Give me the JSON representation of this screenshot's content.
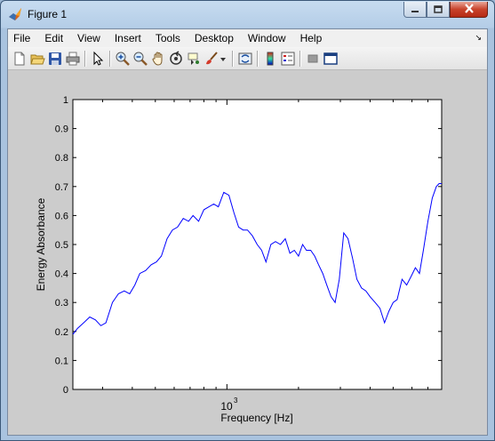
{
  "window": {
    "title": "Figure 1",
    "icon": "matlab-icon",
    "controls": [
      "minimize-icon",
      "maximize-icon",
      "close-icon"
    ]
  },
  "menubar": {
    "items": [
      "File",
      "Edit",
      "View",
      "Insert",
      "Tools",
      "Desktop",
      "Window",
      "Help"
    ],
    "overflow_icon": "chevron-icon"
  },
  "toolbar": {
    "icons": [
      "new-figure-icon",
      "open-file-icon",
      "save-icon",
      "print-icon",
      "edit-plot-icon",
      "zoom-in-icon",
      "zoom-out-icon",
      "pan-icon",
      "rotate-3d-icon",
      "data-cursor-icon",
      "brush-icon",
      "link-plot-icon",
      "colorbar-icon",
      "legend-icon",
      "hide-plot-tools-icon",
      "show-plot-tools-icon"
    ]
  },
  "chart_data": {
    "type": "line",
    "title": "",
    "xlabel": "Frequency [Hz]",
    "ylabel": "Energy Absorbance",
    "x_scale": "log",
    "xlim": [
      225,
      8000
    ],
    "ylim": [
      0,
      1
    ],
    "yticks": [
      0,
      0.1,
      0.2,
      0.3,
      0.4,
      0.5,
      0.6,
      0.7,
      0.8,
      0.9,
      1
    ],
    "ytick_labels": [
      "0",
      "0.1",
      "0.2",
      "0.3",
      "0.4",
      "0.5",
      "0.6",
      "0.7",
      "0.8",
      "0.9",
      "1"
    ],
    "xtick_label_base": "10",
    "xtick_label_exp": "3",
    "xtick_major": 1000,
    "grid": false,
    "line_color": "#0000ff",
    "series": [
      {
        "x": [
          225,
          235,
          250,
          265,
          280,
          295,
          310,
          330,
          350,
          370,
          390,
          410,
          430,
          455,
          480,
          505,
          530,
          560,
          590,
          620,
          655,
          690,
          720,
          760,
          800,
          840,
          880,
          920,
          970,
          1020,
          1070,
          1120,
          1170,
          1220,
          1280,
          1340,
          1400,
          1460,
          1530,
          1600,
          1680,
          1760,
          1840,
          1920,
          2000,
          2080,
          2160,
          2250,
          2340,
          2430,
          2530,
          2630,
          2740,
          2850,
          2970,
          3100,
          3230,
          3380,
          3520,
          3680,
          3840,
          4000,
          4200,
          4400,
          4600,
          4800,
          5000,
          5200,
          5450,
          5700,
          5950,
          6200,
          6450,
          6700,
          7000,
          7300,
          7600,
          7800,
          8000
        ],
        "y": [
          0.19,
          0.21,
          0.23,
          0.25,
          0.24,
          0.22,
          0.23,
          0.3,
          0.33,
          0.34,
          0.33,
          0.36,
          0.4,
          0.41,
          0.43,
          0.44,
          0.46,
          0.52,
          0.55,
          0.56,
          0.59,
          0.58,
          0.6,
          0.58,
          0.62,
          0.63,
          0.64,
          0.63,
          0.68,
          0.67,
          0.61,
          0.56,
          0.55,
          0.55,
          0.53,
          0.5,
          0.48,
          0.44,
          0.5,
          0.51,
          0.5,
          0.52,
          0.47,
          0.48,
          0.46,
          0.5,
          0.48,
          0.48,
          0.46,
          0.43,
          0.4,
          0.36,
          0.32,
          0.3,
          0.38,
          0.54,
          0.52,
          0.45,
          0.38,
          0.35,
          0.34,
          0.32,
          0.3,
          0.28,
          0.23,
          0.27,
          0.3,
          0.31,
          0.38,
          0.36,
          0.39,
          0.42,
          0.4,
          0.48,
          0.58,
          0.66,
          0.7,
          0.71,
          0.71
        ]
      }
    ]
  }
}
